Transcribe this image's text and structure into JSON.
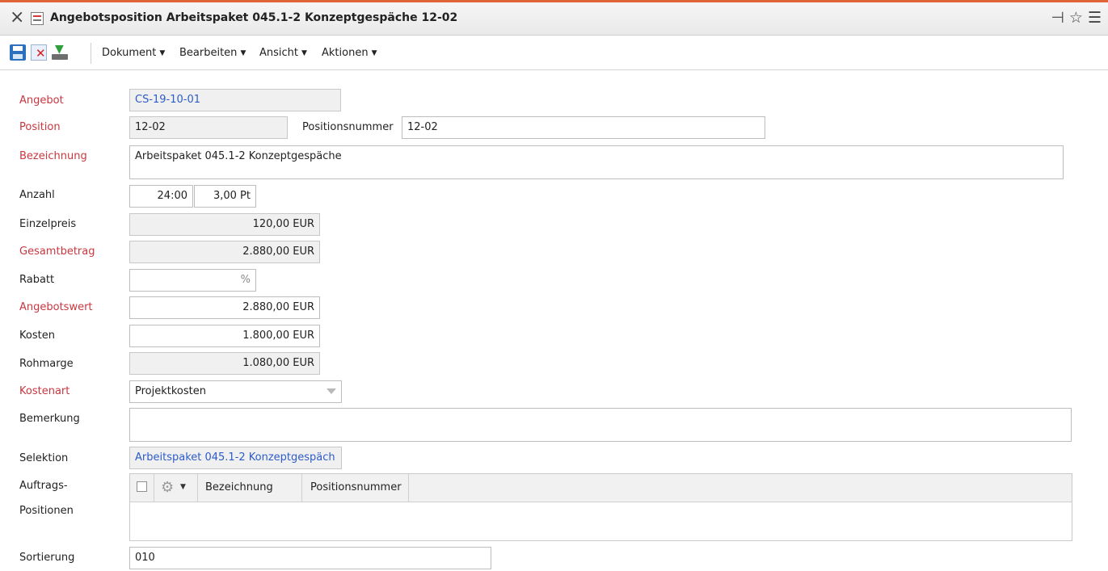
{
  "window": {
    "title": "Angebotsposition Arbeitspaket 045.1-2 Konzeptgespäche 12-02",
    "icons": [
      "close-icon",
      "document-icon",
      "pin-icon",
      "star-icon",
      "hamburger-menu-icon"
    ]
  },
  "toolbar": {
    "menus": [
      "Dokument",
      "Bearbeiten",
      "Ansicht",
      "Aktionen"
    ],
    "icons": [
      "save-icon",
      "discard-icon",
      "export-icon"
    ]
  },
  "colors": {
    "accent_line": "#e0663a",
    "required_label": "#c8373f",
    "link": "#2d5cc8"
  },
  "form": {
    "angebot": {
      "label": "Angebot",
      "value": "CS-19-10-01"
    },
    "position": {
      "label": "Position",
      "value": "12-02"
    },
    "positionsnummer": {
      "label": "Positionsnummer",
      "value": "12-02"
    },
    "bezeichnung": {
      "label": "Bezeichnung",
      "value": "Arbeitspaket 045.1-2 Konzeptgespäche"
    },
    "anzahl": {
      "label": "Anzahl",
      "hours": "24:00",
      "points": "3,00 Pt"
    },
    "einzelpreis": {
      "label": "Einzelpreis",
      "value": "120,00 EUR"
    },
    "gesamtbetrag": {
      "label": "Gesamtbetrag",
      "value": "2.880,00 EUR"
    },
    "rabatt": {
      "label": "Rabatt",
      "value": "",
      "unit": "%"
    },
    "angebotswert": {
      "label": "Angebotswert",
      "value": "2.880,00 EUR"
    },
    "kosten": {
      "label": "Kosten",
      "value": "1.800,00 EUR"
    },
    "rohmarge": {
      "label": "Rohmarge",
      "value": "1.080,00 EUR"
    },
    "kostenart": {
      "label": "Kostenart",
      "value": "Projektkosten"
    },
    "bemerkung": {
      "label": "Bemerkung",
      "value": ""
    },
    "selektion": {
      "label": "Selektion",
      "value": "Arbeitspaket 045.1-2 Konzeptgespäch"
    },
    "auftragspositionen": {
      "label_line1": "Auftrags-",
      "label_line2": "Positionen",
      "columns": [
        "Bezeichnung",
        "Positionsnummer"
      ],
      "rows": []
    },
    "sortierung": {
      "label": "Sortierung",
      "value": "010"
    }
  }
}
